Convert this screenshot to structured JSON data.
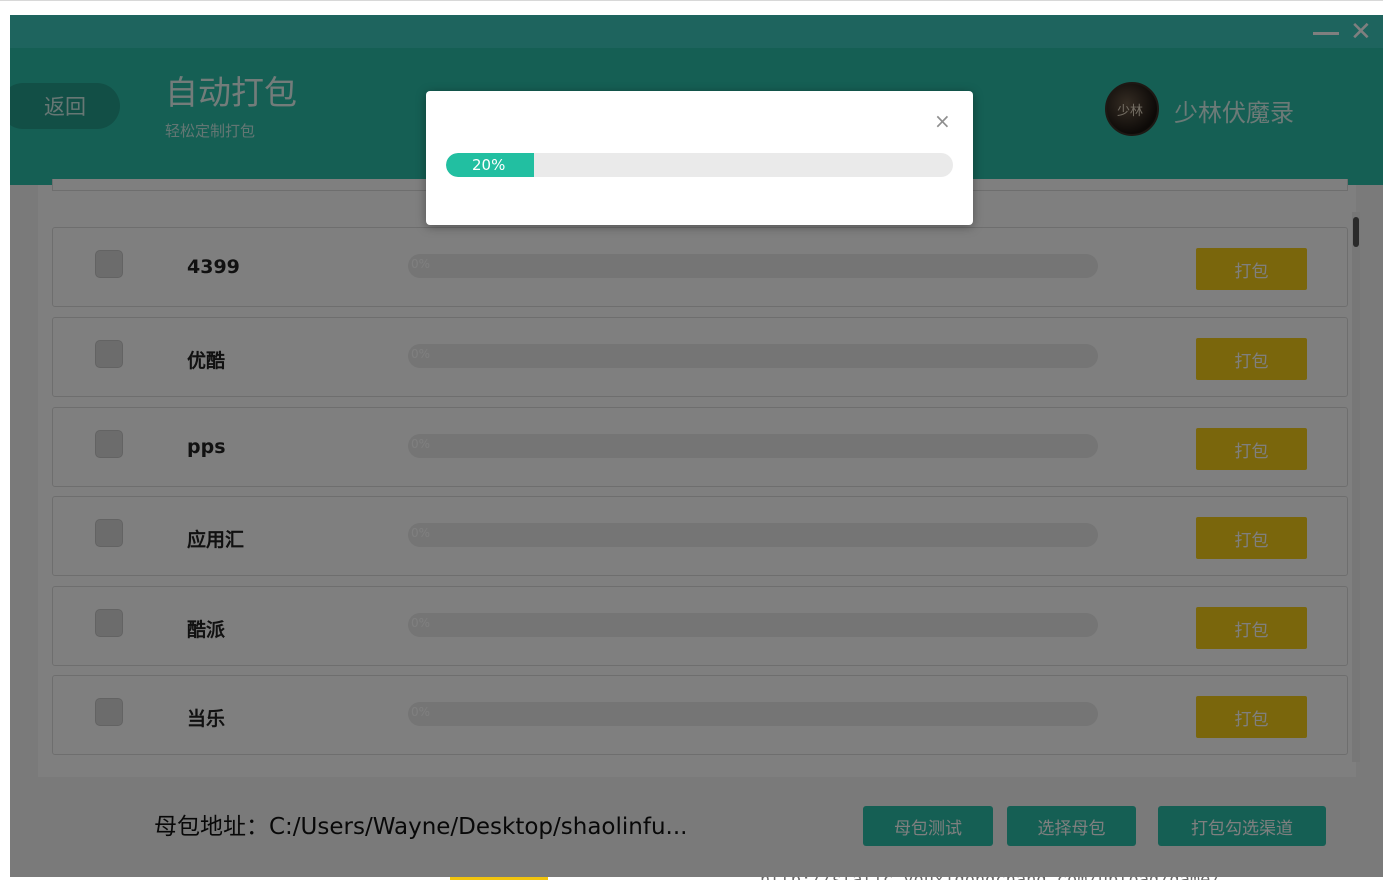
{
  "window": {
    "title_bar_controls": {
      "minimize_icon": "minimize-icon",
      "close_symbol": "✕"
    }
  },
  "header": {
    "back_label": "返回",
    "title": "自动打包",
    "subtitle": "轻松定制打包",
    "game_name": "少林伏魔录",
    "game_logo_char": "少林"
  },
  "channels": [
    {
      "name": "4399",
      "progress_label": "0%",
      "progress": 0,
      "button": "打包"
    },
    {
      "name": "优酷",
      "progress_label": "0%",
      "progress": 0,
      "button": "打包"
    },
    {
      "name": "pps",
      "progress_label": "0%",
      "progress": 0,
      "button": "打包"
    },
    {
      "name": "应用汇",
      "progress_label": "0%",
      "progress": 0,
      "button": "打包"
    },
    {
      "name": "酷派",
      "progress_label": "0%",
      "progress": 0,
      "button": "打包"
    },
    {
      "name": "当乐",
      "progress_label": "0%",
      "progress": 0,
      "button": "打包"
    }
  ],
  "footer": {
    "path_text": "母包地址：C:/Users/Wayne/Desktop/shaolinfu...",
    "test_button": "母包测试",
    "select_button": "选择母包",
    "pack_selected_button": "打包勾选渠道"
  },
  "modal": {
    "close_symbol": "×",
    "progress_label": "20%",
    "progress": 0.2
  },
  "background": {
    "url_text": "http://static.youxigongchang.com/upload/game/"
  },
  "colors": {
    "titlebar": "#3cc8bd",
    "header": "#2bbfa8",
    "accent": "#22bfa1",
    "pack_button": "#f4cc18"
  }
}
